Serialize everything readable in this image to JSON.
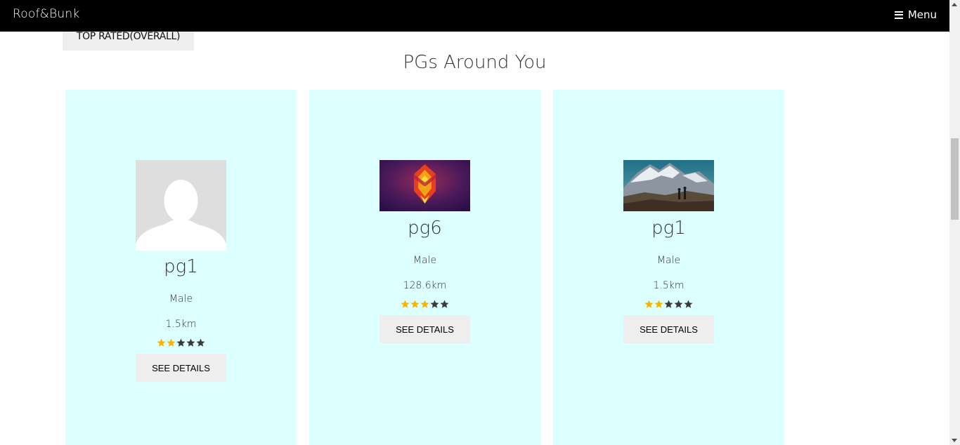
{
  "navbar": {
    "brand": "Roof&Bunk",
    "menu_label": "Menu",
    "menu_icon": "hamburger-icon"
  },
  "filter": {
    "top_rated_label": "TOP RATED(OVERALL)"
  },
  "section": {
    "title": "PGs Around You"
  },
  "colors": {
    "card_bg": "#dcffff",
    "star_filled": "#f7b500",
    "star_empty": "#3a3a3a",
    "button_bg": "#eeeeee"
  },
  "cards": [
    {
      "name": "pg1",
      "gender": "Male",
      "distance": "1.5km",
      "rating": 2,
      "rating_max": 5,
      "image": "default-avatar",
      "button_label": "SEE DETAILS"
    },
    {
      "name": "pg6",
      "gender": "Male",
      "distance": "128.6km",
      "rating": 3,
      "rating_max": 5,
      "image": "abstract-geometric",
      "button_label": "SEE DETAILS"
    },
    {
      "name": "pg1",
      "gender": "Male",
      "distance": "1.5km",
      "rating": 2,
      "rating_max": 5,
      "image": "mountain-hikers",
      "button_label": "SEE DETAILS"
    }
  ]
}
